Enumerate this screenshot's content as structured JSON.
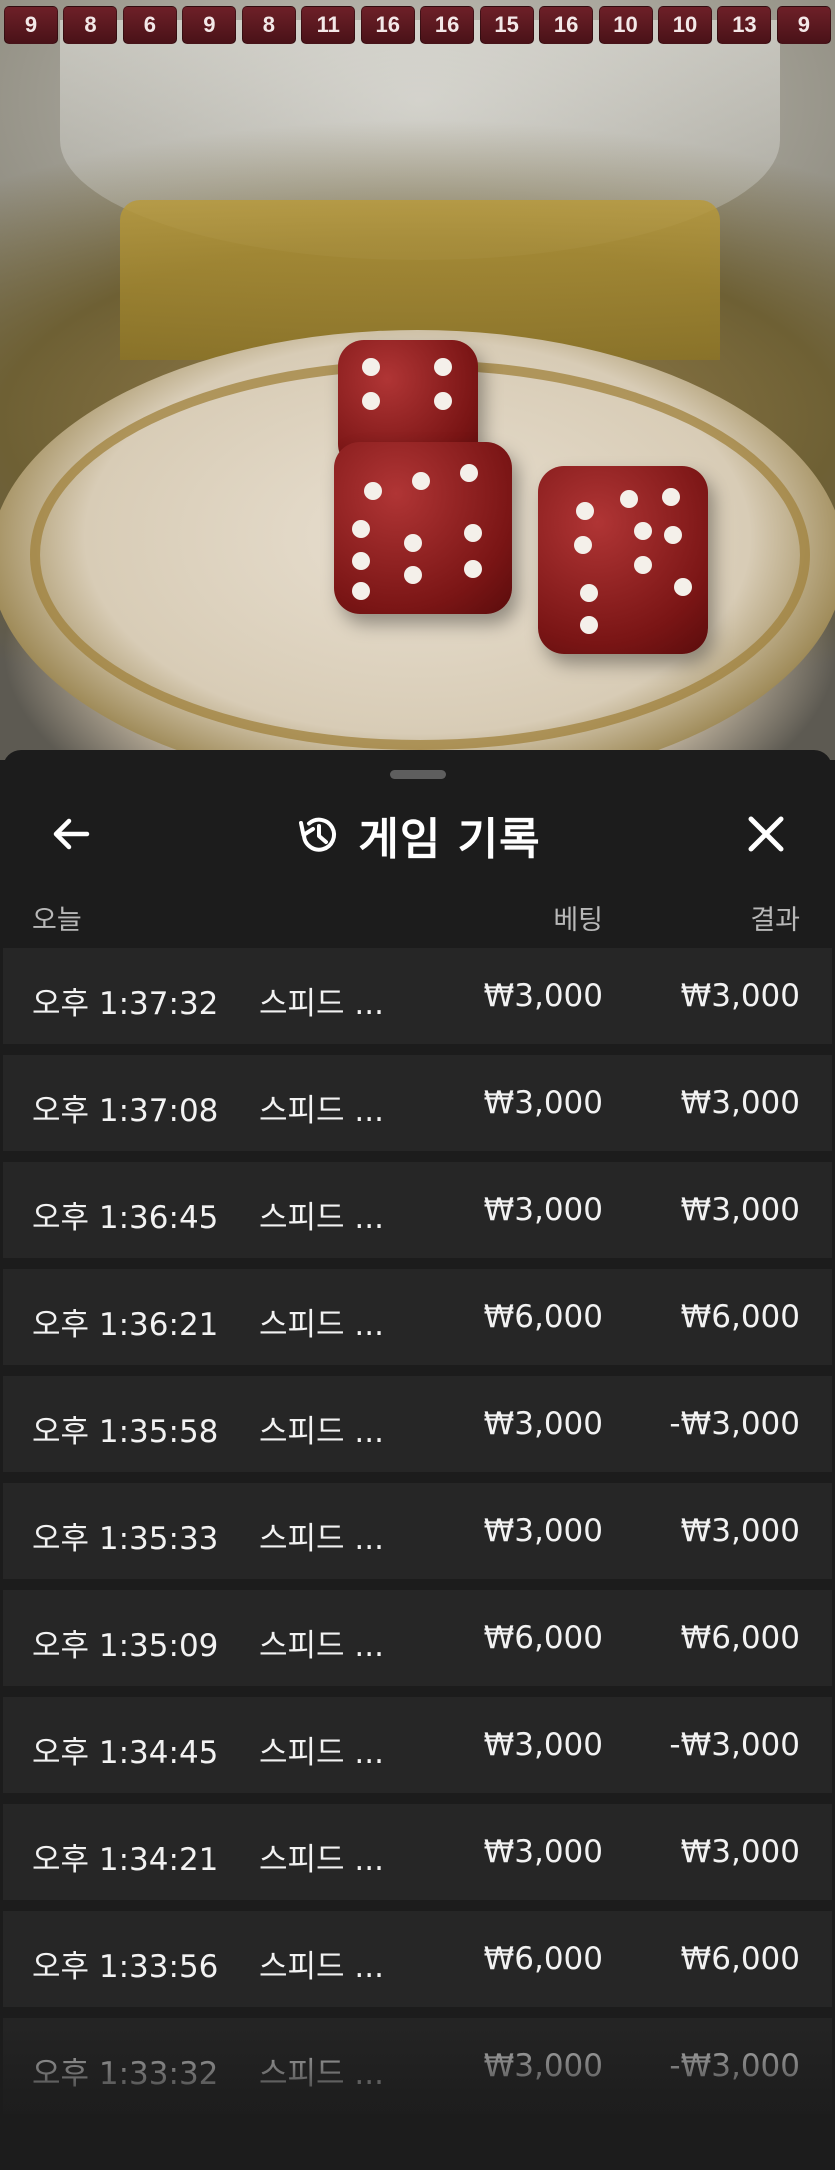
{
  "results_history": [
    "9",
    "8",
    "6",
    "9",
    "8",
    "11",
    "16",
    "16",
    "15",
    "16",
    "10",
    "10",
    "13",
    "9"
  ],
  "header": {
    "title": "게임 기록",
    "back_icon": "arrow-left-icon",
    "history_icon": "history-clock-icon",
    "close_icon": "close-icon"
  },
  "columns": {
    "date": "오늘",
    "bet": "베팅",
    "result": "결과"
  },
  "rows": [
    {
      "time": "오후 1:37:32",
      "game": "스피드 ...",
      "bet": "₩3,000",
      "result": "₩3,000"
    },
    {
      "time": "오후 1:37:08",
      "game": "스피드 ...",
      "bet": "₩3,000",
      "result": "₩3,000"
    },
    {
      "time": "오후 1:36:45",
      "game": "스피드 ...",
      "bet": "₩3,000",
      "result": "₩3,000"
    },
    {
      "time": "오후 1:36:21",
      "game": "스피드 ...",
      "bet": "₩6,000",
      "result": "₩6,000"
    },
    {
      "time": "오후 1:35:58",
      "game": "스피드 ...",
      "bet": "₩3,000",
      "result": "-₩3,000"
    },
    {
      "time": "오후 1:35:33",
      "game": "스피드 ...",
      "bet": "₩3,000",
      "result": "₩3,000"
    },
    {
      "time": "오후 1:35:09",
      "game": "스피드 ...",
      "bet": "₩6,000",
      "result": "₩6,000"
    },
    {
      "time": "오후 1:34:45",
      "game": "스피드 ...",
      "bet": "₩3,000",
      "result": "-₩3,000"
    },
    {
      "time": "오후 1:34:21",
      "game": "스피드 ...",
      "bet": "₩3,000",
      "result": "₩3,000"
    },
    {
      "time": "오후 1:33:56",
      "game": "스피드 ...",
      "bet": "₩6,000",
      "result": "₩6,000"
    },
    {
      "time": "오후 1:33:32",
      "game": "스피드 ...",
      "bet": "₩3,000",
      "result": "-₩3,000"
    }
  ],
  "colors": {
    "sheet_bg": "#1c1c1c",
    "row_bg": "#262626",
    "chip_bg": "#5c1820",
    "text": "#f2f2f2",
    "muted": "#b8b8b8"
  }
}
